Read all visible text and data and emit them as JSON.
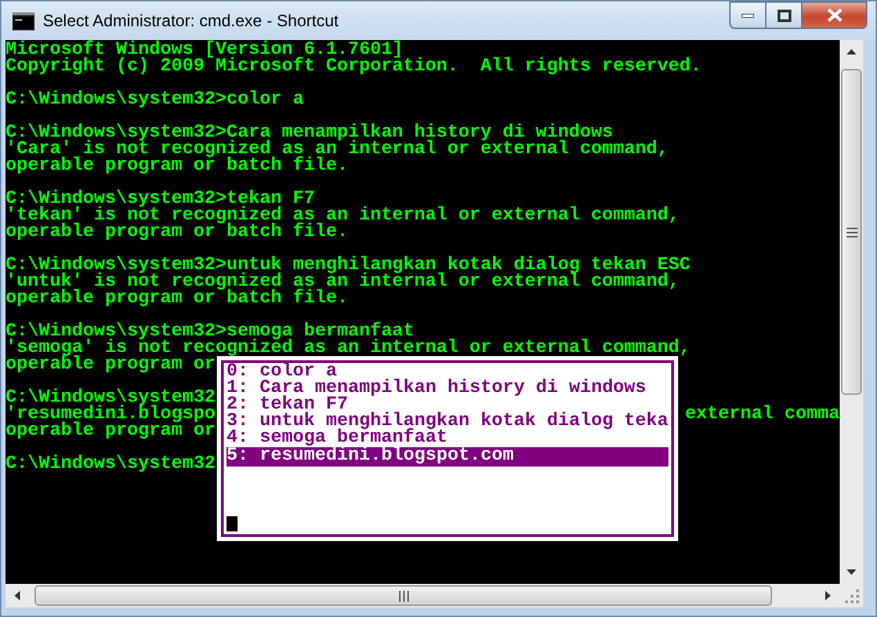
{
  "window": {
    "title": "Select Administrator: cmd.exe - Shortcut"
  },
  "console": {
    "blocks": [
      {
        "lines": [
          {
            "text": "Microsoft Windows [Version 6.1.7601]"
          },
          {
            "text": "Copyright (c) 2009 Microsoft Corporation.  All rights reserved."
          }
        ]
      },
      {
        "lines": [
          {
            "text": "C:\\Windows\\system32>color a"
          }
        ]
      },
      {
        "lines": [
          {
            "text": "C:\\Windows\\system32>Cara menampilkan history di windows"
          },
          {
            "text": "'Cara' is not recognized as an internal or external command,"
          },
          {
            "text": "operable program or batch file."
          }
        ]
      },
      {
        "lines": [
          {
            "text": "C:\\Windows\\system32>tekan F7"
          },
          {
            "text": "'tekan' is not recognized as an internal or external command,"
          },
          {
            "text": "operable program or batch file."
          }
        ]
      },
      {
        "lines": [
          {
            "text": "C:\\Windows\\system32>untuk menghilangkan kotak dialog tekan ESC"
          },
          {
            "text": "'untuk' is not recognized as an internal or external command,"
          },
          {
            "text": "operable program or batch file."
          }
        ]
      },
      {
        "lines": [
          {
            "text": "C:\\Windows\\system32>semoga bermanfaat"
          },
          {
            "text": "'semoga' is not recognized as an internal or external command,"
          },
          {
            "text": "operable program or"
          }
        ]
      },
      {
        "lines": [
          {
            "text": "C:\\Windows\\system32"
          },
          {
            "text": "'resumedini.blogspo",
            "right": "external comma"
          },
          {
            "text": "operable program or"
          }
        ]
      },
      {
        "lines": [
          {
            "text": "C:\\Windows\\system32"
          }
        ]
      }
    ]
  },
  "history_popup": {
    "items": [
      {
        "label": "0: color a",
        "selected": false
      },
      {
        "label": "1: Cara menampilkan history di windows",
        "selected": false
      },
      {
        "label": "2: tekan F7",
        "selected": false
      },
      {
        "label": "3: untuk menghilangkan kotak dialog teka",
        "selected": false
      },
      {
        "label": "4: semoga bermanfaat",
        "selected": false
      },
      {
        "label": "5: resumedini.blogspot.com",
        "selected": true
      }
    ]
  }
}
